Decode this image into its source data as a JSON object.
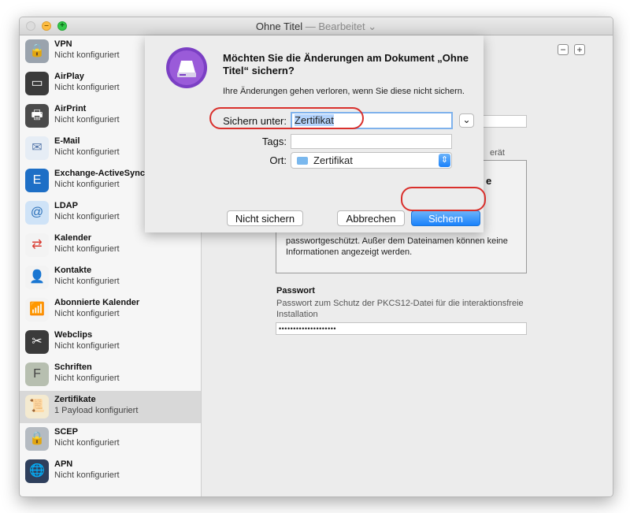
{
  "window": {
    "title": "Ohne Titel",
    "title_edited": "— Bearbeitet ⌄",
    "traffic_lights": [
      "close",
      "minimize",
      "zoom"
    ],
    "minimize_glyph": "–",
    "zoom_glyph": "+"
  },
  "sidebar": {
    "items": [
      {
        "name": "VPN",
        "status": "Nicht konfiguriert",
        "icon": "vpn-lock-icon",
        "glyph": "🔒"
      },
      {
        "name": "AirPlay",
        "status": "Nicht konfiguriert",
        "icon": "airplay-icon",
        "glyph": "▭"
      },
      {
        "name": "AirPrint",
        "status": "Nicht konfiguriert",
        "icon": "printer-icon",
        "glyph": "🖶"
      },
      {
        "name": "E-Mail",
        "status": "Nicht konfiguriert",
        "icon": "mail-stamp-icon",
        "glyph": "✉"
      },
      {
        "name": "Exchange-ActiveSync",
        "status": "Nicht konfiguriert",
        "icon": "exchange-icon",
        "glyph": "E"
      },
      {
        "name": "LDAP",
        "status": "Nicht konfiguriert",
        "icon": "ldap-at-icon",
        "glyph": "@"
      },
      {
        "name": "Kalender",
        "status": "Nicht konfiguriert",
        "icon": "calendar-sync-icon",
        "glyph": "⇄"
      },
      {
        "name": "Kontakte",
        "status": "Nicht konfiguriert",
        "icon": "contacts-sync-icon",
        "glyph": "👤"
      },
      {
        "name": "Abonnierte Kalender",
        "status": "Nicht konfiguriert",
        "icon": "subscribed-calendar-icon",
        "glyph": "📶"
      },
      {
        "name": "Webclips",
        "status": "Nicht konfiguriert",
        "icon": "webclip-scissors-icon",
        "glyph": "✂"
      },
      {
        "name": "Schriften",
        "status": "Nicht konfiguriert",
        "icon": "font-icon",
        "glyph": "F"
      },
      {
        "name": "Zertifikate",
        "status": "1 Payload konfiguriert",
        "icon": "certificate-icon",
        "glyph": "📜"
      },
      {
        "name": "SCEP",
        "status": "Nicht konfiguriert",
        "icon": "scep-lock-icon",
        "glyph": "🔒"
      },
      {
        "name": "APN",
        "status": "Nicht konfiguriert",
        "icon": "apn-globe-icon",
        "glyph": "🌐"
      }
    ],
    "selected_index": 11
  },
  "content": {
    "minus_glyph": "−",
    "plus_glyph": "+",
    "device_partial": "erät",
    "cert_box_heading_partial": "e",
    "cert_box_desc_line1": "passwortgeschützt. Außer dem Dateinamen können keine",
    "cert_box_desc_line2": "Informationen angezeigt werden.",
    "password_label": "Passwort",
    "password_help_line1": "Passwort zum Schutz der PKCS12-Datei für die interaktionsfreie",
    "password_help_line2": "Installation",
    "password_value": "••••••••••••••••••••"
  },
  "dialog": {
    "icon": "configurator-drive-icon",
    "title": "Möchten Sie die Änderungen am Dokument „Ohne Titel“ sichern?",
    "subtitle": "Ihre Änderungen gehen verloren, wenn Sie diese nicht sichern.",
    "save_as_label": "Sichern unter:",
    "save_as_value": "Zertifikat",
    "expand_glyph": "⌄",
    "tags_label": "Tags:",
    "tags_value": "",
    "location_label": "Ort:",
    "location_value": "Zertifikat",
    "location_icon": "folder-icon",
    "location_arrows": "⇕",
    "dont_save_button": "Nicht sichern",
    "cancel_button": "Abbrechen",
    "save_button": "Sichern"
  },
  "colors": {
    "accent_blue": "#1a82fb",
    "annotation_red": "#d9302c",
    "folder_blue": "#7ab8ee"
  }
}
